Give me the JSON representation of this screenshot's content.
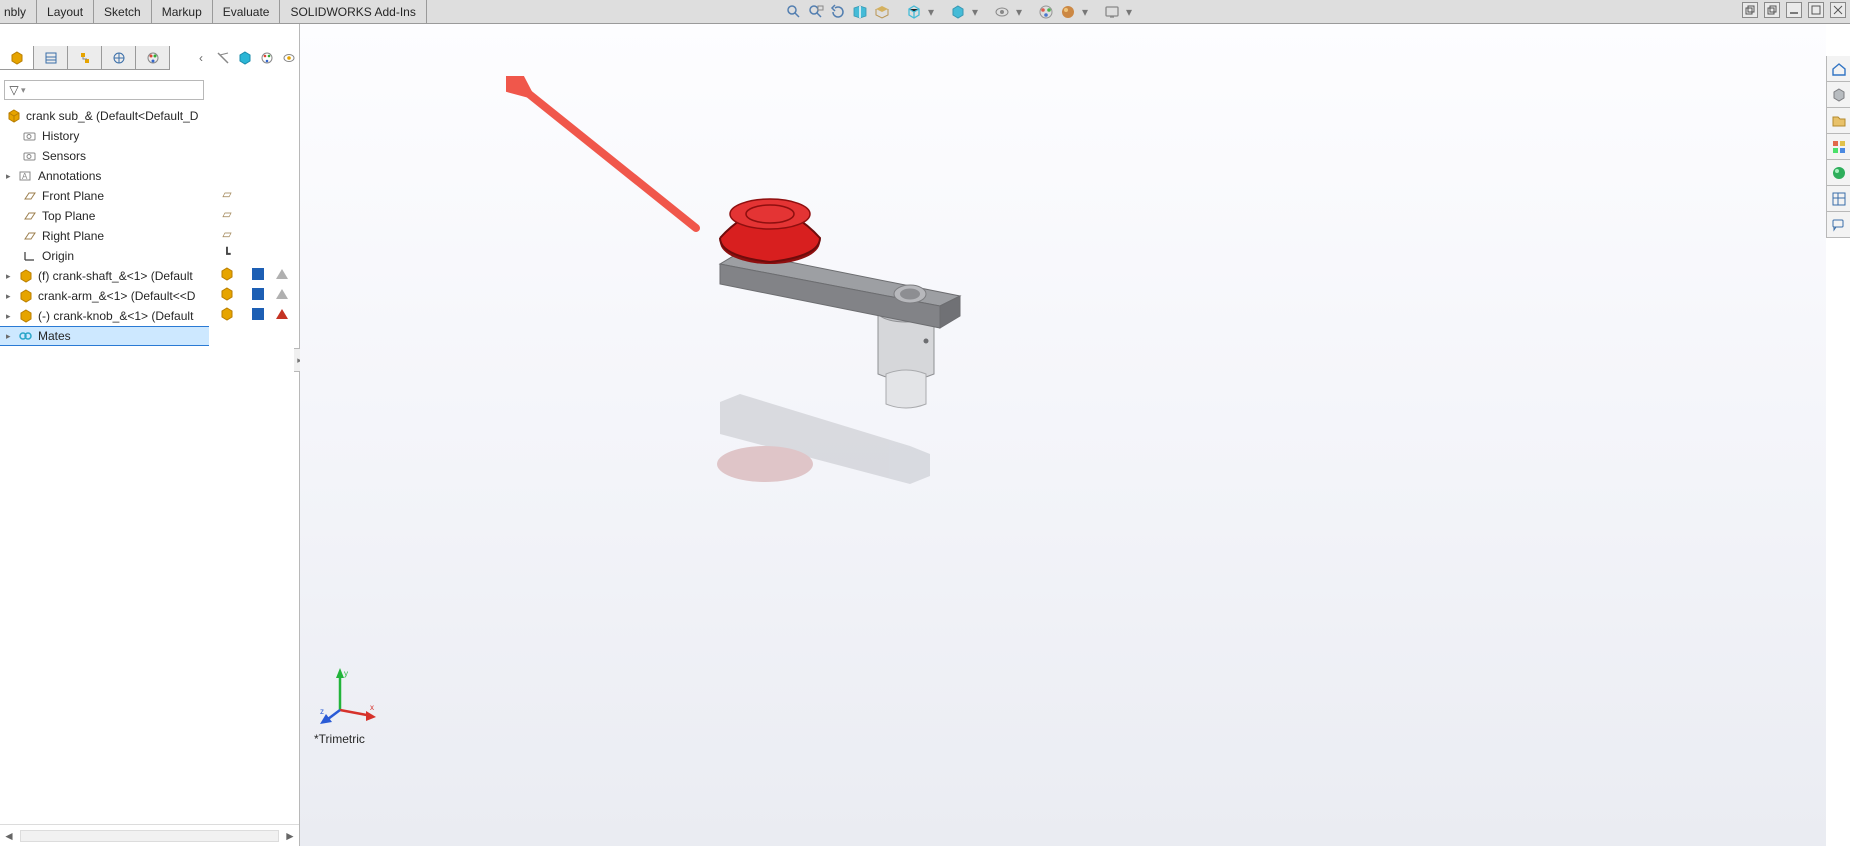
{
  "tabs": {
    "assembly_trunc": "nbly",
    "layout": "Layout",
    "sketch": "Sketch",
    "markup": "Markup",
    "evaluate": "Evaluate",
    "addins": "SOLIDWORKS Add-Ins"
  },
  "feature_tree": {
    "root": "crank sub_&  (Default<Default_D",
    "history": "History",
    "sensors": "Sensors",
    "annotations": "Annotations",
    "front_plane": "Front Plane",
    "top_plane": "Top Plane",
    "right_plane": "Right Plane",
    "origin": "Origin",
    "part1": "(f) crank-shaft_&<1> (Default",
    "part2": "crank-arm_&<1> (Default<<D",
    "part3": "(-) crank-knob_&<1> (Default",
    "mates": "Mates"
  },
  "view_label": "*Trimetric",
  "triad": {
    "x": "x",
    "y": "y",
    "z": "z"
  },
  "heads_up_icons": [
    "zoom-to-fit",
    "zoom-area",
    "previous-view",
    "section-view",
    "dynamic-annotation",
    "view-orientation",
    "display-style",
    "hide-show",
    "edit-appearance",
    "apply-scene",
    "view-settings"
  ],
  "fm_tab_icons": [
    "feature-manager",
    "property-manager",
    "configuration-manager",
    "dimxpert-manager",
    "display-manager"
  ],
  "display_filter_icons": [
    "arrow-left",
    "hide-show-primary",
    "cube",
    "appearance",
    "visibility-eye"
  ],
  "taskpane_icons": [
    "home",
    "resources",
    "file-explorer",
    "view-palette",
    "appearances",
    "custom-properties",
    "forum"
  ],
  "window_controls": [
    "restore-child",
    "restore",
    "minimize",
    "maximize",
    "close"
  ],
  "annotation": {
    "purpose": "pointer-to-display-filter-toolbar"
  }
}
